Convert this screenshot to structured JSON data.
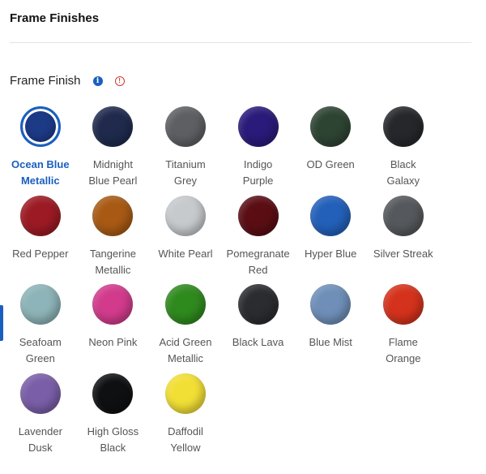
{
  "header": {
    "title": "Frame Finishes"
  },
  "field": {
    "label": "Frame Finish",
    "info_glyph": "i",
    "alert_glyph": "!"
  },
  "finishes": [
    {
      "line1": "Ocean Blue",
      "line2": "Metallic",
      "color": "#1d3a86",
      "selected": true
    },
    {
      "line1": "Midnight",
      "line2": "Blue Pearl",
      "color": "#1f2a4d"
    },
    {
      "line1": "Titanium",
      "line2": "Grey",
      "color": "#5d5f63"
    },
    {
      "line1": "Indigo",
      "line2": "Purple",
      "color": "#2a1a7a"
    },
    {
      "line1": "OD Green",
      "line2": "",
      "color": "#2e4433"
    },
    {
      "line1": "Black",
      "line2": "Galaxy",
      "color": "#25272b"
    },
    {
      "line1": "Red Pepper",
      "line2": "",
      "color": "#9c1a24"
    },
    {
      "line1": "Tangerine",
      "line2": "Metallic",
      "color": "#a85a14"
    },
    {
      "line1": "White Pearl",
      "line2": "",
      "color": "#c7cacd"
    },
    {
      "line1": "Pomegranate",
      "line2": "Red",
      "color": "#5a0e14"
    },
    {
      "line1": "Hyper Blue",
      "line2": "",
      "color": "#2360b9"
    },
    {
      "line1": "Silver Streak",
      "line2": "",
      "color": "#55585c"
    },
    {
      "line1": "Seafoam",
      "line2": "Green",
      "color": "#8db4b8"
    },
    {
      "line1": "Neon Pink",
      "line2": "",
      "color": "#d23b8c"
    },
    {
      "line1": "Acid Green",
      "line2": "Metallic",
      "color": "#2f8a1e"
    },
    {
      "line1": "Black Lava",
      "line2": "",
      "color": "#2a2c30"
    },
    {
      "line1": "Blue Mist",
      "line2": "",
      "color": "#6f8fb8"
    },
    {
      "line1": "Flame",
      "line2": "Orange",
      "color": "#d4321c"
    },
    {
      "line1": "Lavender",
      "line2": "Dusk",
      "color": "#7a5ea8"
    },
    {
      "line1": "High Gloss",
      "line2": "Black",
      "color": "#0f1012"
    },
    {
      "line1": "Daffodil",
      "line2": "Yellow",
      "color": "#f2df36"
    }
  ],
  "colors": {
    "accent": "#1a5fc0",
    "alert": "#d23a2e"
  }
}
